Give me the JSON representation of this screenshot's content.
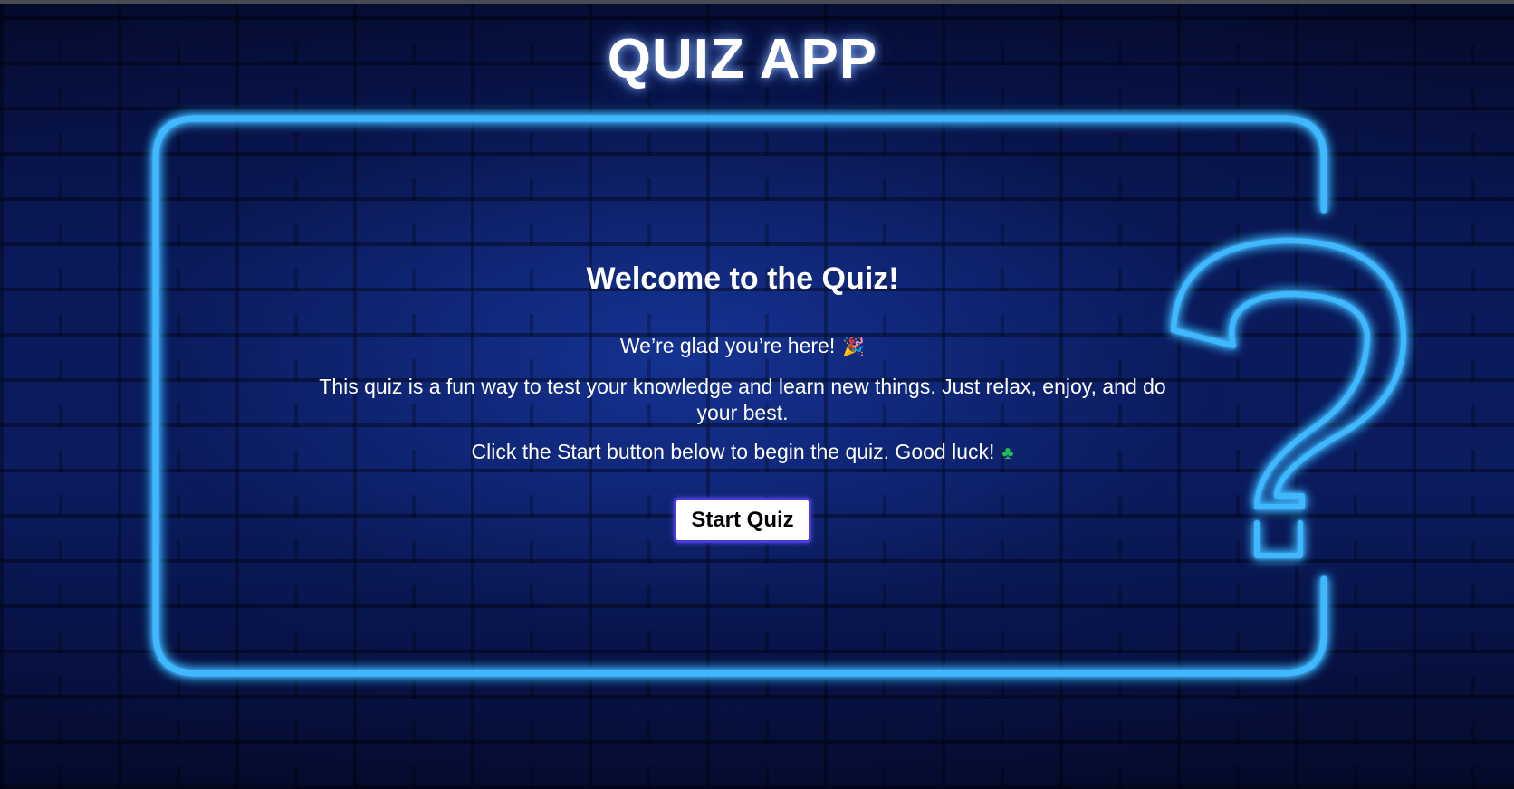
{
  "app": {
    "title": "QUIZ APP"
  },
  "welcome": {
    "heading": "Welcome to the Quiz!",
    "greeting": "We’re glad you’re here!",
    "greeting_icon": "party-popper-icon",
    "description": "This quiz is a fun way to test your knowledge and learn new things. Just relax, enjoy, and do your best.",
    "instruction": "Click the Start button below to begin the quiz. Good luck!",
    "instruction_icon": "four-leaf-clover-icon"
  },
  "actions": {
    "start_label": "Start Quiz"
  },
  "colors": {
    "background": "#06103a",
    "neon": "#3fb8ff",
    "button_border": "#4b3ae0",
    "text": "#ffffff"
  }
}
